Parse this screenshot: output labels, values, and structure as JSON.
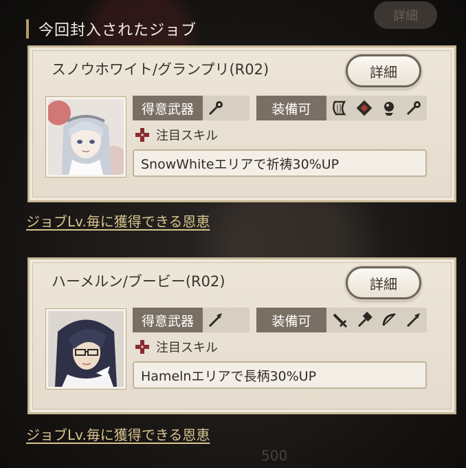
{
  "header": {
    "top_detail_label": "詳細",
    "section_title": "今回封入されたジョブ"
  },
  "jobs": [
    {
      "name": "スノウホワイト/グランプリ(R02)",
      "detail_label": "詳細",
      "weapon_tag": "得意武器",
      "equip_tag": "装備可",
      "favored_weapon_icon": "staff-icon",
      "equip_icons": [
        "harp-icon",
        "tome-icon",
        "orb-icon",
        "staff-icon"
      ],
      "skill_heading": "注目スキル",
      "skill_text": "SnowWhiteエリアで祈祷30%UP"
    },
    {
      "name": "ハーメルン/ブービー(R02)",
      "detail_label": "詳細",
      "weapon_tag": "得意武器",
      "equip_tag": "装備可",
      "favored_weapon_icon": "spear-icon",
      "equip_icons": [
        "sword-icon",
        "hammer-icon",
        "bow-icon",
        "spear-icon"
      ],
      "skill_heading": "注目スキル",
      "skill_text": "Hamelnエリアで長柄30%UP"
    }
  ],
  "benefit_link_label": "ジョブLv.毎に獲得できる恩恵",
  "ghost_bottom_number": "500"
}
